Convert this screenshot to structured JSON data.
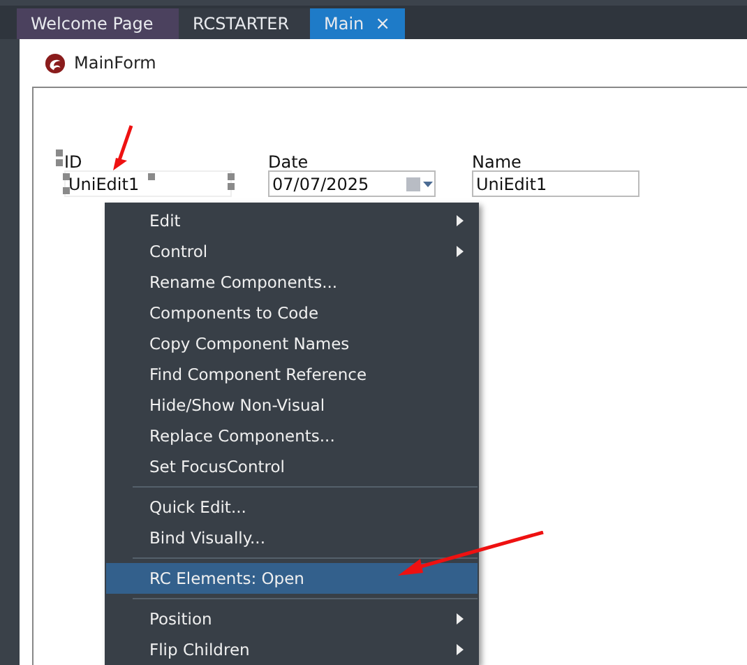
{
  "tabs": [
    {
      "label": "Welcome Page",
      "selected": false
    },
    {
      "label": "RCSTARTER",
      "selected": false
    },
    {
      "label": "Main",
      "selected": true,
      "close": "×"
    }
  ],
  "form": {
    "title": "MainForm",
    "fields": [
      {
        "label": "ID",
        "value": "UniEdit1",
        "kind": "edit",
        "selected": true
      },
      {
        "label": "Date",
        "value": "07/07/2025",
        "kind": "date",
        "selected": false
      },
      {
        "label": "Name",
        "value": "UniEdit1",
        "kind": "edit",
        "selected": false
      }
    ]
  },
  "context_menu": [
    {
      "kind": "item",
      "label": "Edit",
      "submenu": true,
      "selected": false
    },
    {
      "kind": "item",
      "label": "Control",
      "submenu": true,
      "selected": false
    },
    {
      "kind": "item",
      "label": "Rename Components...",
      "submenu": false,
      "selected": false
    },
    {
      "kind": "item",
      "label": "Components to Code",
      "submenu": false,
      "selected": false
    },
    {
      "kind": "item",
      "label": "Copy Component Names",
      "submenu": false,
      "selected": false
    },
    {
      "kind": "item",
      "label": "Find Component Reference",
      "submenu": false,
      "selected": false
    },
    {
      "kind": "item",
      "label": "Hide/Show Non-Visual",
      "submenu": false,
      "selected": false
    },
    {
      "kind": "item",
      "label": "Replace Components...",
      "submenu": false,
      "selected": false
    },
    {
      "kind": "item",
      "label": "Set FocusControl",
      "submenu": false,
      "selected": false
    },
    {
      "kind": "separator"
    },
    {
      "kind": "item",
      "label": "Quick Edit...",
      "submenu": false,
      "selected": false
    },
    {
      "kind": "item",
      "label": "Bind Visually...",
      "submenu": false,
      "selected": false
    },
    {
      "kind": "separator"
    },
    {
      "kind": "item",
      "label": "RC Elements: Open",
      "submenu": false,
      "selected": true
    },
    {
      "kind": "separator"
    },
    {
      "kind": "item",
      "label": "Position",
      "submenu": true,
      "selected": false
    },
    {
      "kind": "item",
      "label": "Flip Children",
      "submenu": true,
      "selected": false
    }
  ]
}
